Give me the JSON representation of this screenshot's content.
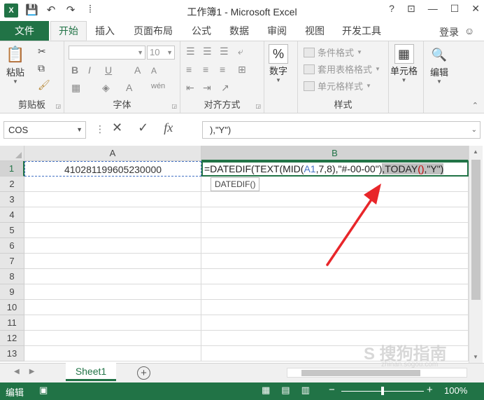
{
  "window": {
    "title": "工作簿1 - Microsoft Excel",
    "logo_text": "X",
    "help": "?",
    "controls": [
      "⊡",
      "—",
      "☐",
      "✕"
    ]
  },
  "tabs": {
    "file": "文件",
    "items": [
      "开始",
      "插入",
      "页面布局",
      "公式",
      "数据",
      "审阅",
      "视图",
      "开发工具"
    ],
    "login": "登录"
  },
  "ribbon": {
    "clipboard": {
      "paste": "粘贴",
      "label": "剪贴板"
    },
    "font": {
      "size": "10",
      "label": "字体",
      "bold": "B",
      "italic": "I",
      "underline": "U",
      "grow": "A",
      "shrink": "A",
      "font_color": "A",
      "phonetic": "wén"
    },
    "alignment": {
      "label": "对齐方式"
    },
    "number": {
      "symbol": "%",
      "name": "数字"
    },
    "styles": {
      "label": "样式",
      "conditional": "条件格式",
      "table": "套用表格格式",
      "cell": "单元格样式"
    },
    "cells": {
      "name": "单元格"
    },
    "editing": {
      "name": "编辑"
    }
  },
  "formula_bar": {
    "name_box": "COS",
    "fx": "fx",
    "content": "),\"Y\")"
  },
  "grid": {
    "columns": [
      "A",
      "B"
    ],
    "rows": [
      "1",
      "2",
      "3",
      "4",
      "5",
      "6",
      "7",
      "8",
      "9",
      "10",
      "11",
      "12",
      "13"
    ],
    "a1": "410281199605230000",
    "b1_parts": {
      "p1": "=DATEDIF(TEXT(MID(",
      "ref": "A1",
      "p2": ",7,8),\"#-00-00\")",
      "p3": ",TODAY",
      "p4": "()",
      "p5": ",\"Y\")"
    },
    "tooltip": "DATEDIF()"
  },
  "sheets": {
    "tabs": [
      "Sheet1"
    ],
    "add": "+"
  },
  "status": {
    "mode": "编辑",
    "zoom": "100%",
    "minus": "−",
    "plus": "+"
  },
  "watermark": "S 搜狗指南",
  "watermark_sub": "zhinan.sogou.com",
  "colors": {
    "accent": "#217346",
    "ref_blue": "#4472c4",
    "arrow_red": "#e8262a"
  }
}
